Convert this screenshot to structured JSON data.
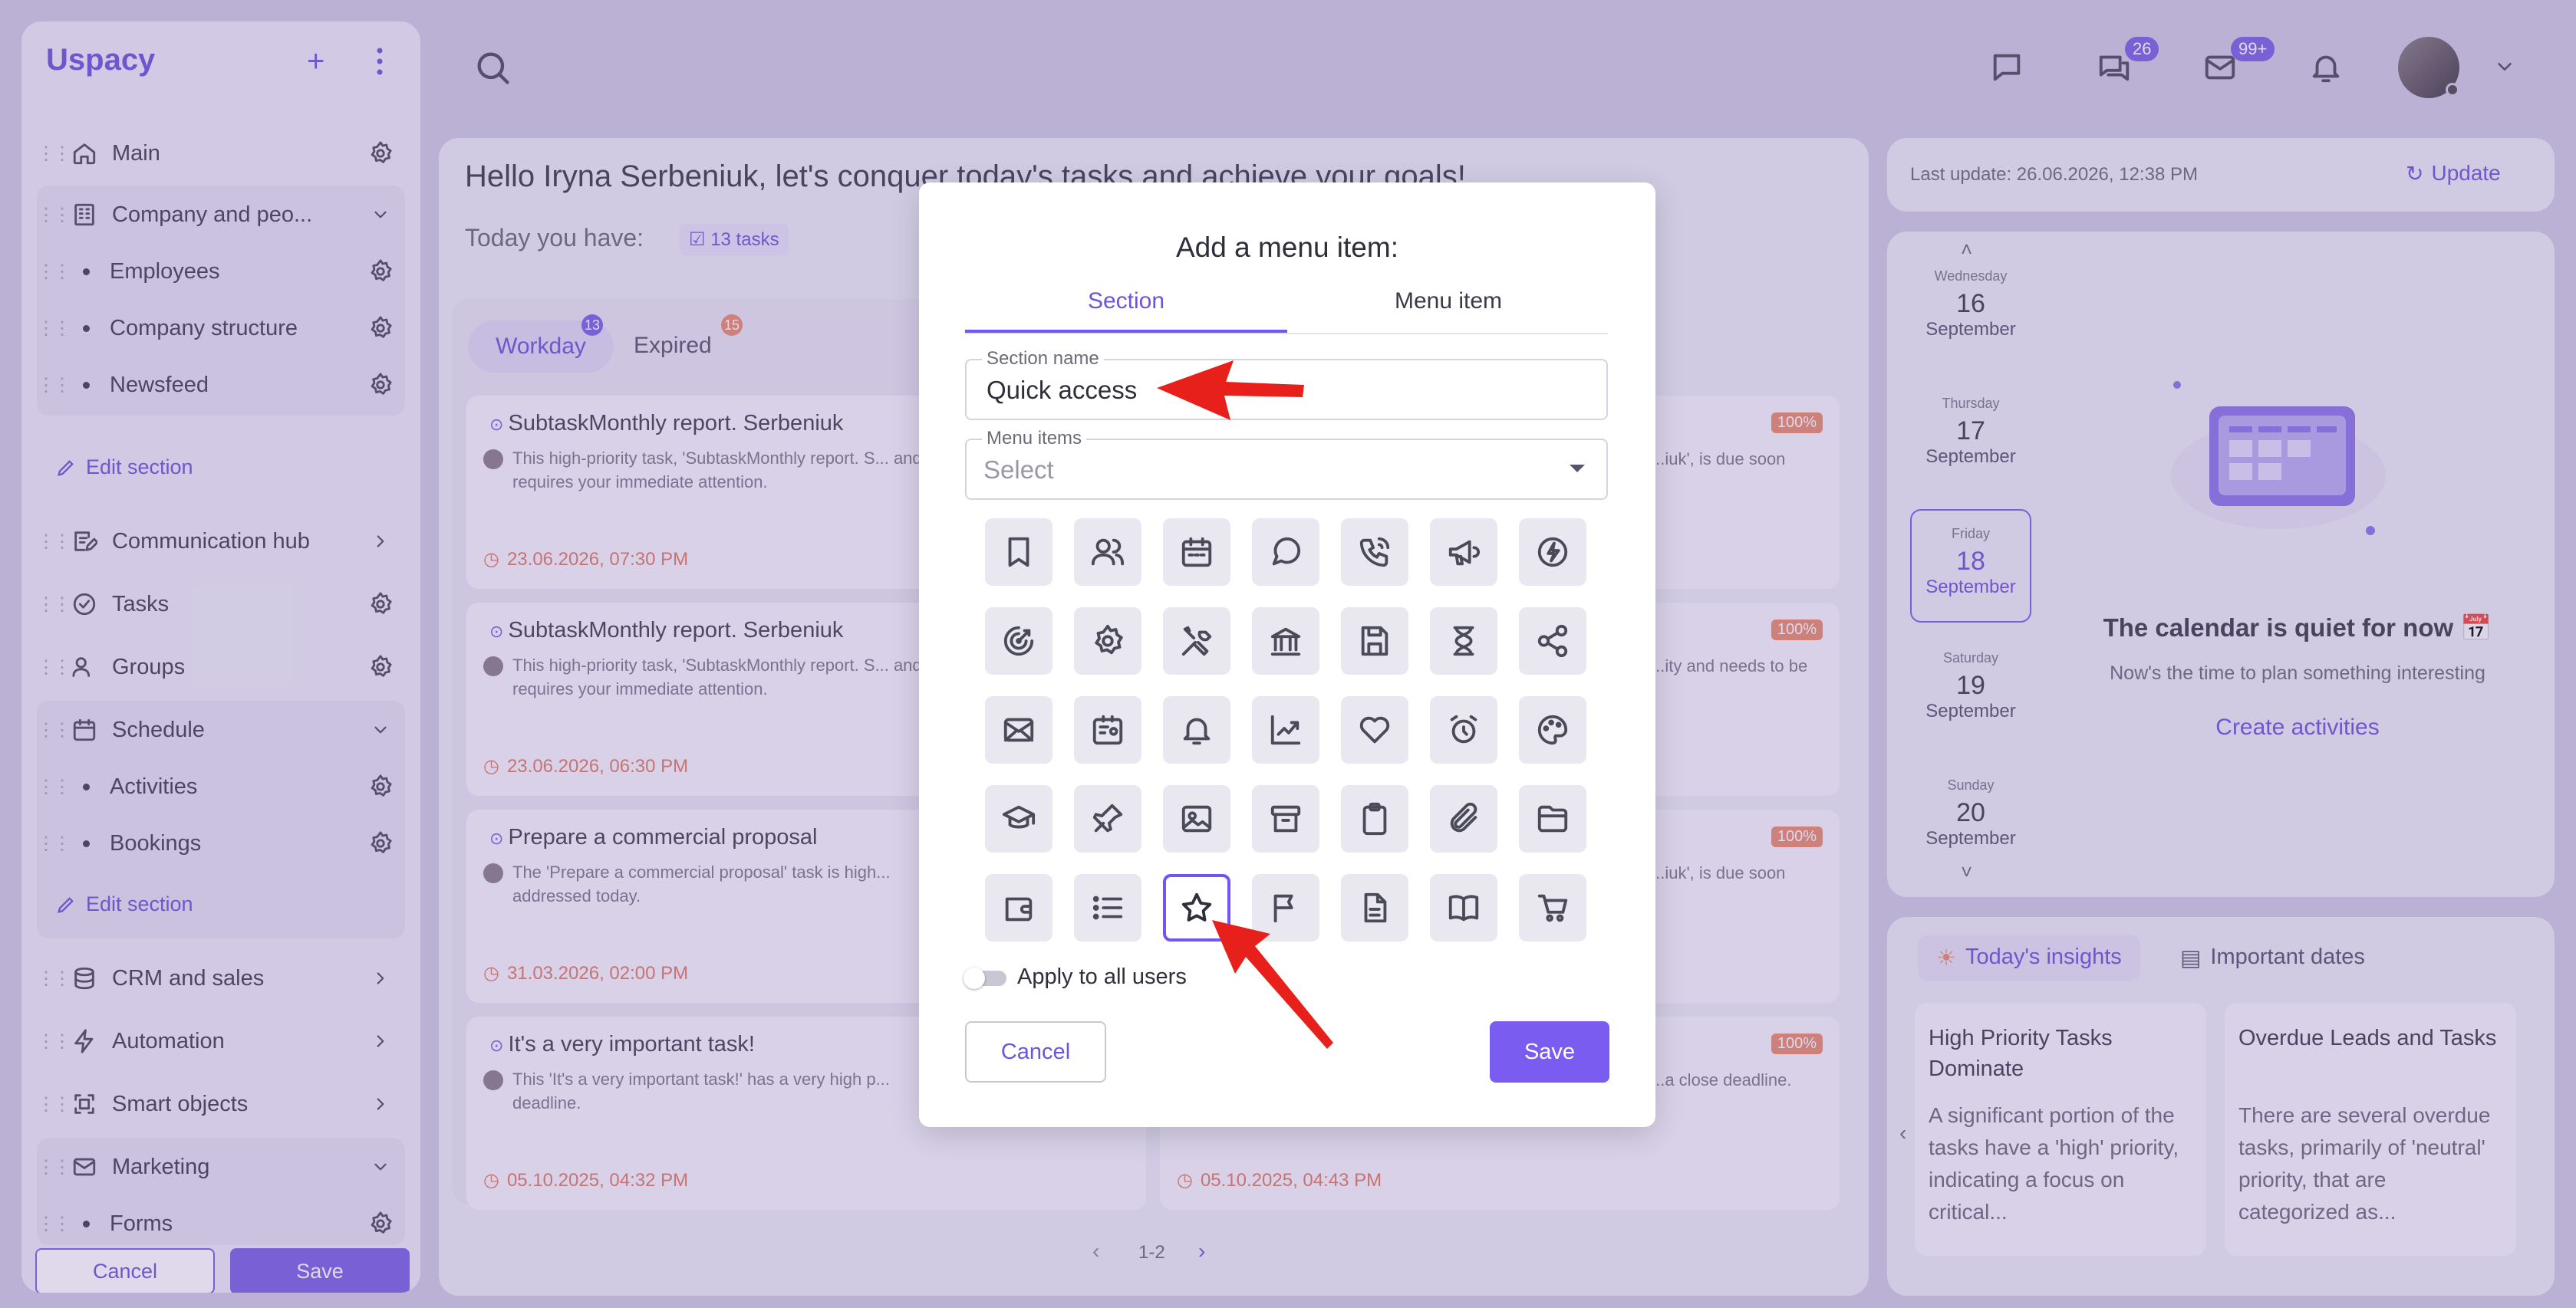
{
  "app": {
    "logo": "Uspacy"
  },
  "sidebar": {
    "items": [
      {
        "label": "Main"
      },
      {
        "label": "Company and peo..."
      },
      {
        "label": "Employees"
      },
      {
        "label": "Company structure"
      },
      {
        "label": "Newsfeed"
      },
      {
        "label": "Communication hub"
      },
      {
        "label": "Tasks"
      },
      {
        "label": "Groups"
      },
      {
        "label": "Schedule"
      },
      {
        "label": "Activities"
      },
      {
        "label": "Bookings"
      },
      {
        "label": "CRM and sales"
      },
      {
        "label": "Automation"
      },
      {
        "label": "Smart objects"
      },
      {
        "label": "Marketing"
      },
      {
        "label": "Forms"
      }
    ],
    "edit_section_label": "Edit section",
    "cancel_label": "Cancel",
    "save_label": "Save"
  },
  "header": {
    "chat_badge": "26",
    "mail_badge": "99+"
  },
  "main": {
    "greeting": "Hello Iryna Serbeniuk, let's conquer today's tasks and achieve your goals!",
    "today_label": "Today you have:",
    "tasks_chip": "13 tasks",
    "tabs": [
      {
        "label": "Workday",
        "count": "13"
      },
      {
        "label": "Expired",
        "count": "15"
      }
    ],
    "tasks_left": [
      {
        "title": "SubtaskMonthly report. Serbeniuk",
        "desc": "This high-priority task, 'SubtaskMonthly report. S... and requires your immediate attention.",
        "date": "23.06.2026, 07:30 PM"
      },
      {
        "title": "SubtaskMonthly report. Serbeniuk",
        "desc": "This high-priority task, 'SubtaskMonthly report. S... and requires your immediate attention.",
        "date": "23.06.2026, 06:30 PM"
      },
      {
        "title": "Prepare a commercial proposal",
        "desc": "The 'Prepare a commercial proposal' task is high... addressed today.",
        "date": "31.03.2026, 02:00 PM"
      },
      {
        "title": "It's a very important task!",
        "desc": "This 'It's a very important task!' has a very high p... deadline.",
        "date": "05.10.2025, 04:32 PM"
      }
    ],
    "tasks_right": [
      {
        "desc": "...iuk', is due soon",
        "pct": "100%"
      },
      {
        "desc": "...ity and needs to be",
        "pct": "100%"
      },
      {
        "desc": "...iuk', is due soon",
        "pct": "100%"
      },
      {
        "desc": "...a close deadline.",
        "pct": "100%",
        "date": "05.10.2025, 04:43 PM"
      }
    ],
    "pagination": "1-2"
  },
  "calendar": {
    "last_update": "Last update: 26.06.2026, 12:38 PM",
    "update_label": "Update",
    "days": [
      {
        "weekday": "Wednesday",
        "day": "16",
        "month": "September"
      },
      {
        "weekday": "Thursday",
        "day": "17",
        "month": "September"
      },
      {
        "weekday": "Friday",
        "day": "18",
        "month": "September"
      },
      {
        "weekday": "Saturday",
        "day": "19",
        "month": "September"
      },
      {
        "weekday": "Sunday",
        "day": "20",
        "month": "September"
      }
    ],
    "quiet_title": "The calendar is quiet for now 📅",
    "quiet_sub": "Now's the time to plan something interesting",
    "create_label": "Create activities"
  },
  "insights": {
    "tab_insights": "Today's insights",
    "tab_dates": "Important dates",
    "cards": [
      {
        "title": "High Priority Tasks Dominate",
        "text": "A significant portion of the tasks have a 'high' priority, indicating a focus on critical..."
      },
      {
        "title": "Overdue Leads and Tasks",
        "text": "There are several overdue tasks, primarily of 'neutral' priority, that are categorized as..."
      }
    ]
  },
  "modal": {
    "title": "Add a menu item:",
    "tab_section": "Section",
    "tab_menu_item": "Menu item",
    "section_name_label": "Section name",
    "section_name_value": "Quick access",
    "menu_items_label": "Menu items",
    "menu_items_placeholder": "Select",
    "icons": [
      "bookmark-icon",
      "users-icon",
      "calendar-icon",
      "chat-icon",
      "phone-call-icon",
      "megaphone-icon",
      "lightning-icon",
      "target-icon",
      "settings-icon",
      "tools-icon",
      "bank-icon",
      "save-icon",
      "hourglass-icon",
      "share-icon",
      "mail-icon",
      "id-card-icon",
      "bell-icon",
      "chart-line-icon",
      "heart-icon",
      "alarm-icon",
      "palette-icon",
      "graduation-cap-icon",
      "pin-icon",
      "image-icon",
      "archive-icon",
      "clipboard-icon",
      "paperclip-icon",
      "folder-icon",
      "wallet-icon",
      "list-icon",
      "star-icon",
      "flag-icon",
      "document-icon",
      "book-icon",
      "cart-icon"
    ],
    "selected_icon": "star-icon",
    "apply_all_label": "Apply to all users",
    "cancel_label": "Cancel",
    "save_label": "Save",
    "accent": "#7355f3"
  },
  "annotations": {
    "arrow_color": "#e8201c"
  }
}
